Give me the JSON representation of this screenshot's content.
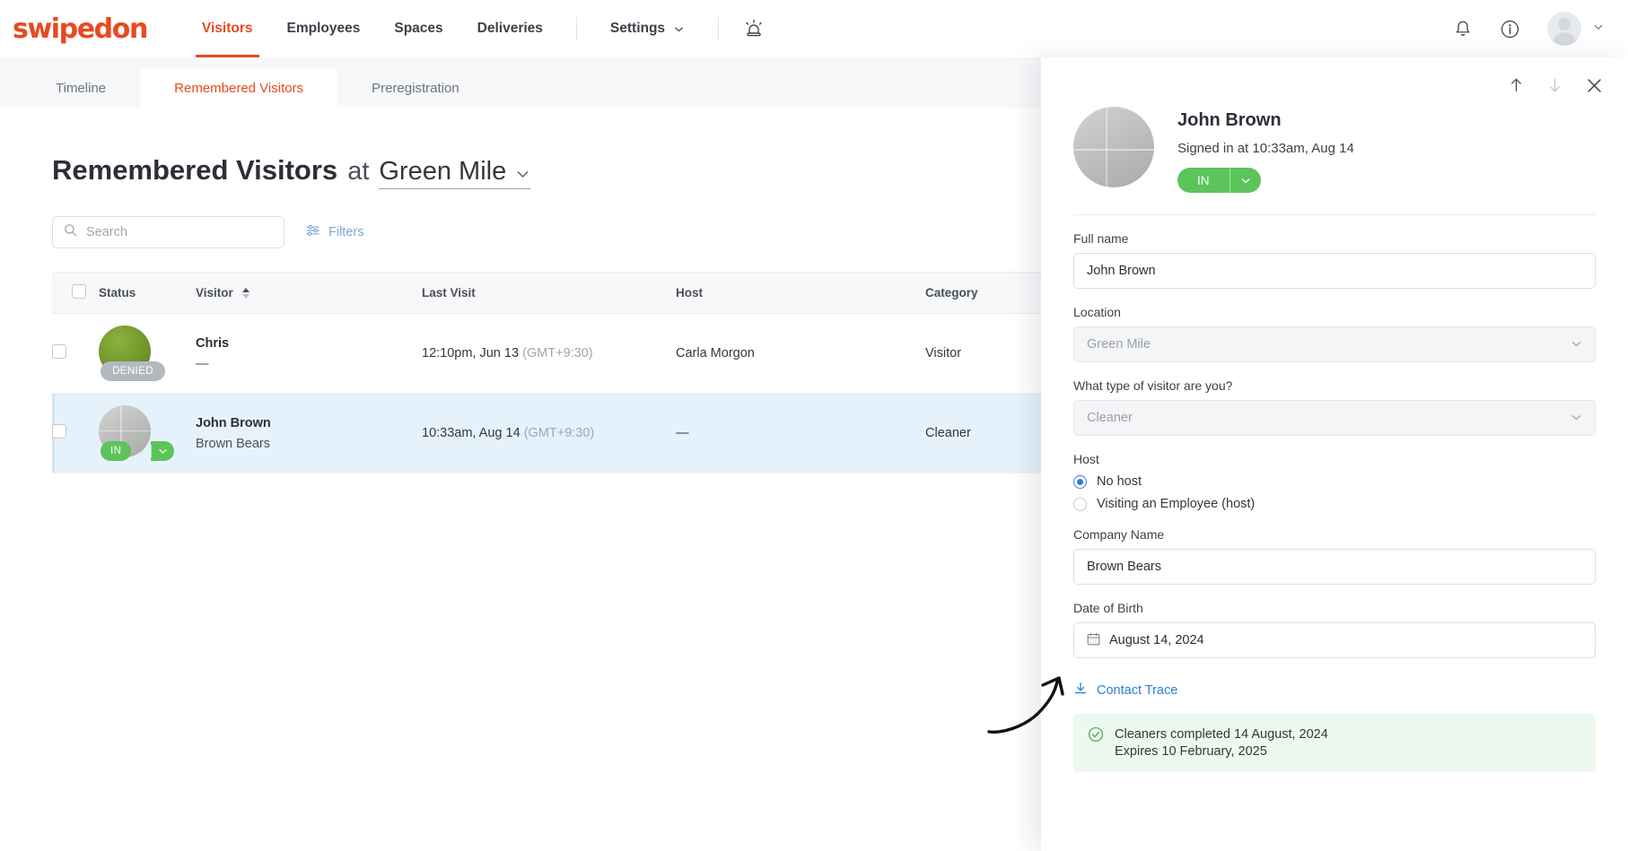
{
  "header": {
    "logo": "swipedon",
    "nav": [
      {
        "label": "Visitors",
        "active": true
      },
      {
        "label": "Employees",
        "active": false
      },
      {
        "label": "Spaces",
        "active": false
      },
      {
        "label": "Deliveries",
        "active": false
      },
      {
        "label": "Settings",
        "active": false,
        "caret": true
      }
    ],
    "icons": [
      "siren-icon",
      "bell-icon",
      "info-icon",
      "avatar",
      "chevron-down-icon"
    ]
  },
  "tabs": [
    {
      "label": "Timeline",
      "active": false
    },
    {
      "label": "Remembered Visitors",
      "active": true
    },
    {
      "label": "Preregistration",
      "active": false
    }
  ],
  "page": {
    "title": "Remembered Visitors",
    "at": "at",
    "location": "Green Mile"
  },
  "toolbar": {
    "search_value": "",
    "search_placeholder": "Search",
    "filters_label": "Filters"
  },
  "table": {
    "columns": [
      "Status",
      "Visitor",
      "Last Visit",
      "Host",
      "Category"
    ],
    "rows": [
      {
        "name": "Chris",
        "company": "—",
        "last_visit": "12:10pm, Jun 13",
        "timezone": "(GMT+9:30)",
        "host": "Carla Morgon",
        "category": "Visitor",
        "status": "DENIED",
        "status_kind": "denied",
        "avatar_kind": "green",
        "selected": false
      },
      {
        "name": "John Brown",
        "company": "Brown Bears",
        "last_visit": "10:33am, Aug 14",
        "timezone": "(GMT+9:30)",
        "host": "—",
        "category": "Cleaner",
        "status": "IN",
        "status_kind": "in",
        "avatar_kind": "grey",
        "selected": true
      }
    ]
  },
  "panel": {
    "name": "John Brown",
    "signed_in": "Signed in at 10:33am, Aug 14",
    "status_label": "IN",
    "fields": {
      "full_name_label": "Full name",
      "full_name_value": "John Brown",
      "location_label": "Location",
      "location_value": "Green Mile",
      "visitor_type_label": "What type of visitor are you?",
      "visitor_type_value": "Cleaner",
      "host_label": "Host",
      "host_option_none": "No host",
      "host_option_employee": "Visiting an Employee (host)",
      "company_label": "Company Name",
      "company_value": "Brown Bears",
      "dob_label": "Date of Birth",
      "dob_value": "August 14, 2024"
    },
    "contact_trace": "Contact Trace",
    "notice": {
      "line1": "Cleaners completed 14 August, 2024",
      "line2": "Expires 10 February, 2025"
    }
  },
  "colors": {
    "brand": "#e8491f",
    "link": "#2f7fd4",
    "filters": "#7fa7d4",
    "green": "#5cc45a",
    "notice_bg": "#edf8ee",
    "row_selected": "#e6f2fb",
    "denied": "#b3b8bf"
  }
}
